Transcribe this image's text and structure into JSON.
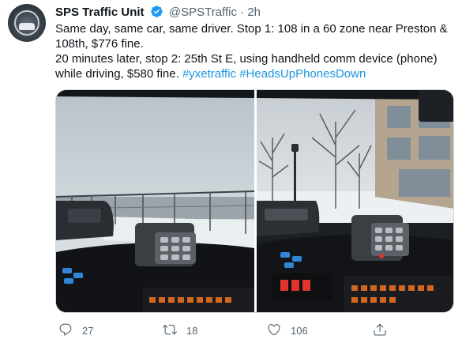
{
  "account": {
    "display_name": "SPS Traffic Unit",
    "handle": "@SPSTraffic",
    "separator": "·",
    "time": "2h",
    "verified": true
  },
  "tweet": {
    "text_line1": "Same day, same car, same driver. Stop 1: 108 in a 60 zone near Preston & 108th, $776 fine.",
    "text_line2_plain": "20 minutes later, stop 2: 25th St E, using handheld comm device (phone) while driving, $580 fine.",
    "hashtag1": "#yxetraffic",
    "hashtag2": "#HeadsUpPhonesDown"
  },
  "actions": {
    "reply": {
      "icon": "reply-icon",
      "count": "27"
    },
    "retweet": {
      "icon": "retweet-icon",
      "count": "18"
    },
    "like": {
      "icon": "heart-icon",
      "count": "106"
    },
    "share": {
      "icon": "share-icon"
    }
  },
  "colors": {
    "accent": "#1b95e0",
    "verified": "#1d9bf0",
    "secondary_text": "#536471"
  }
}
